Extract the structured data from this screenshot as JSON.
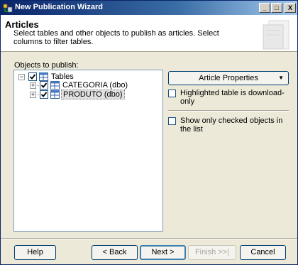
{
  "window": {
    "title": "New Publication Wizard",
    "minimize_label": "_",
    "maximize_label": "□",
    "close_label": "X"
  },
  "header": {
    "title": "Articles",
    "description": "Select tables and other objects to publish as articles. Select columns to filter tables."
  },
  "objects": {
    "label": "Objects to publish:",
    "root": {
      "label": "Tables",
      "checked": true,
      "expander": "−"
    },
    "items": [
      {
        "label": "CATEGORIA (dbo)",
        "checked": true,
        "expander": "+"
      },
      {
        "label": "PRODUTO (dbo)",
        "checked": true,
        "expander": "+",
        "selected": true
      }
    ]
  },
  "right_panel": {
    "article_properties_label": "Article Properties",
    "dropdown_arrow": "▼",
    "download_only_label": "Highlighted table is download-only",
    "download_only_checked": false,
    "show_checked_label": "Show only checked objects in the list",
    "show_checked_checked": false
  },
  "footer": {
    "help": "Help",
    "back": "< Back",
    "next": "Next >",
    "finish": "Finish >>|",
    "cancel": "Cancel"
  },
  "colors": {
    "title_bar": "#0a246a",
    "dialog_background": "#ece9d8",
    "checkbox_border": "#1c5180"
  }
}
